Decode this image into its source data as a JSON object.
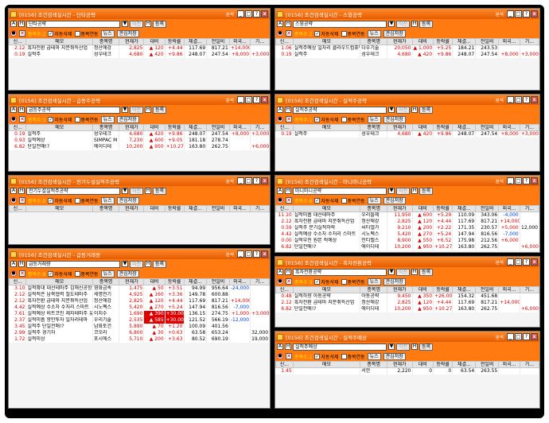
{
  "colors": {
    "title_bar": "#ff7a10",
    "up": "#e00000",
    "down": "#0044dd",
    "stock_highlight": "#ffff70"
  },
  "columns": [
    "신...",
    "메모",
    "종목명",
    "현재가",
    "대비",
    "등락률",
    "체결...",
    "전일비",
    "외국...",
    "기..."
  ],
  "icons": {
    "condition": "record-icon",
    "delete": "close-icon",
    "window": "window-icon",
    "up_arrow": "triangle-up-icon"
  },
  "panels": [
    {
      "window_title": "[0156] 조건검색실시간 - 단타공략",
      "caption": "분석",
      "condition": "단타공략",
      "count": "종목수:2",
      "first_memo": "",
      "rows": [
        [
          "2.12",
          "흑자전환 급테마 지분취득산업",
          "정산애강",
          "2,825",
          "▲ 120",
          "+4.44",
          "117.69",
          "817.21",
          "+14,000",
          ""
        ],
        [
          "0.19",
          "실적주",
          "성우테크",
          "4,680",
          "▲ 420",
          "+9.86",
          "248.07",
          "247.54",
          "+8,000",
          "+3,000"
        ]
      ]
    },
    {
      "window_title": "[0156] 조건검색실시간 - 스윙공략",
      "caption": "분석",
      "condition": "스윙공략",
      "count": "종목수:2",
      "first_memo": "",
      "rows": [
        [
          "1.06",
          "실적주예상 일자리 클라우드컴퓨팅",
          "다우기술",
          "20,050",
          "▲ 1,000",
          "+5.25",
          "184.21",
          "243.53",
          "",
          ""
        ],
        [
          "0.19",
          "실적주",
          "성우테크",
          "4,680",
          "▲ 420",
          "+9.86",
          "248.07",
          "247.54",
          "+8,000",
          "+3,000"
        ]
      ]
    },
    {
      "window_title": "[0156] 조건검색실시간 - 급등주공략",
      "caption": "분석",
      "condition": "급등주공략",
      "count": "종목수:3",
      "first_memo": "",
      "rows": [
        [
          "0.19",
          "실적주",
          "성우테크",
          "4,680",
          "▲ 420",
          "+9.86",
          "248.07",
          "247.54",
          "+8,000",
          "+3,000"
        ],
        [
          "0.93",
          "실적예상",
          "SIMPAC M",
          "7,230",
          "▲ 600",
          "+9.05",
          "181.18",
          "278.74",
          "",
          ""
        ],
        [
          "6.82",
          "단일전매!?",
          "에이디테",
          "10,200",
          "▲ 950",
          "+10.27",
          "163.80",
          "262.75",
          "",
          "+6,000"
        ]
      ]
    },
    {
      "window_title": "[0156] 조건검색실시간 - 실적주공략",
      "caption": "분석",
      "condition": "실적주공략",
      "count": "종목수:1",
      "first_memo": "",
      "rows": [
        [
          "0.19",
          "실적주",
          "성우테크",
          "4,680",
          "▲ 420",
          "+9.86",
          "248.07",
          "247.54",
          "+8,000",
          "+3,000"
        ]
      ]
    },
    {
      "window_title": "[0156] 조건검색실시간 - 전기누설실적주공략",
      "caption": "분석",
      "condition": "전기누설실적주공략",
      "count": "종목수:0",
      "first_memo": "",
      "rows": []
    },
    {
      "window_title": "[0156] 조건검색실시간 - 마니마니공략",
      "caption": "분석",
      "condition": "마니마니공략",
      "count": "종목수:6",
      "first_memo": "",
      "rows": [
        [
          "11.10",
          "실적미흡 대선테마주",
          "우리들제",
          "11,950",
          "▲ 600",
          "+5.29",
          "110.09",
          "343.06",
          "-4,000",
          ""
        ],
        [
          "2.12",
          "흑자전환 급테마 지분취득산업",
          "정산애강",
          "2,825",
          "▲ 120",
          "+4.44",
          "117.69",
          "817.21",
          "+14,000",
          ""
        ],
        [
          "0.59",
          "실적주 분기실적하락",
          "씨티엘가",
          "9,210",
          "▲ 200",
          "+2.22",
          "171.35",
          "230.57",
          "+5,000",
          "12,000"
        ],
        [
          "4.42",
          "실적예상 수소차 수처리 스마트",
          "시노펙스",
          "5,420",
          "▲ 270",
          "+5.24",
          "147.94",
          "816.56",
          "-7,000",
          ""
        ],
        [
          "0.00",
          "실적부진 원본 적예상",
          "인티벨스",
          "8,900",
          "▲ 550",
          "+6.52",
          "175.98",
          "212.56",
          "+6,000",
          ""
        ],
        [
          "6.82",
          "단일전매!?",
          "에이디테",
          "10,200",
          "▲ 950",
          "+10.27",
          "163.80",
          "262.75",
          "",
          "+6,000"
        ]
      ]
    },
    {
      "window_title": "[0156] 조건검색실시간 - 급등거래량",
      "caption": "분석",
      "condition": "급등거래량",
      "count": "종목수:9",
      "first_memo": "",
      "rows": [
        [
          "3.10",
          "실적확대 대선테마주 김해신공항",
          "영화금속",
          "1,475",
          "▲ 50",
          "+3.51",
          "94.99",
          "956.64",
          "-24,000",
          ""
        ],
        [
          "2.12",
          "실적적은 남북협력 철도테마주",
          "세명전기",
          "4,925",
          "▲ 160",
          "+3.36",
          "149.78",
          "600.88",
          "",
          ""
        ],
        [
          "2.12",
          "흑자전환 급테마 지분취득산업",
          "정산애강",
          "2,825",
          "▲ 120",
          "+4.44",
          "117.69",
          "817.21",
          "+14,000",
          ""
        ],
        [
          "4.42",
          "실적예상 수소차 수처리 스마트",
          "시노펙스",
          "5,420",
          "▲ 270",
          "+5.24",
          "147.94",
          "816.56",
          "-7,000",
          ""
        ],
        [
          "7.61",
          "실적예상 비트코인 제지테마주 유",
          "이지수",
          "1,690",
          "▲ 390",
          "+30.00",
          "136.15",
          "274.75",
          "+1,000",
          "+3,000"
        ],
        [
          "2.37",
          "실적미흡 항만투자 일자리테마",
          "우리기술",
          "2,535",
          "▲ 585",
          "+30.00",
          "121.52",
          "566.19",
          "-12,000",
          ""
        ],
        [
          "3.45",
          "실적주 단일전매!?",
          "남화토건",
          "5,890",
          "▲ 70",
          "+1.20",
          "100.09",
          "401.56",
          "",
          ""
        ],
        [
          "2.99",
          "실적주 경기자",
          "코오라",
          "6,800",
          "▲ 30",
          "+0.63",
          "63.58",
          "653.24",
          "",
          "32,000"
        ],
        [
          "1.72",
          "실적미상",
          "포시에스",
          "5,710",
          "▲ 200",
          "+3.63",
          "80.52",
          "690.19",
          "",
          "19,000"
        ]
      ]
    },
    {
      "window_title": "[0156] 조건검색실시간 - 흑자전환공략",
      "caption": "분석",
      "condition": "흑자전환공략",
      "count": "종목수:3",
      "first_memo": "",
      "rows": [
        [
          "0.48",
          "실적하향 아동공략",
          "아동공략",
          "9,450",
          "▲ 350",
          "+26.00",
          "154.32",
          "451.68",
          "",
          ""
        ],
        [
          "2.12",
          "흑자전환 급테마 지분취득산업",
          "정산애강",
          "2,825",
          "▲ 120",
          "+4.44",
          "117.69",
          "817.21",
          "+14,000",
          ""
        ],
        [
          "6.82",
          "단일전매!?",
          "에이디테",
          "10,200",
          "▲ 950",
          "+10.27",
          "163.80",
          "262.75",
          "",
          "+6,000"
        ]
      ]
    },
    {
      "window_title": "[0156] 조건검색실시간 - 실적주예상",
      "caption": "분석",
      "condition": "실적주예상",
      "count": "종목수:1",
      "first_memo": "",
      "rows": [
        [
          "1.45",
          "",
          "서한",
          "2,220",
          "0",
          "0",
          "63.54",
          "263.55",
          "",
          ""
        ]
      ]
    }
  ],
  "labels": {
    "a1": "A",
    "h": "H",
    "prev": "이전",
    "register": "등록",
    "next": "다음",
    "auto_delete": "자동삭제",
    "duplicate": "중복연동",
    "news": "뉴스",
    "save": "관심저장",
    "dropdown": "▼",
    "win_min": "_",
    "win_max": "□",
    "win_close": "x",
    "win_help": "?"
  }
}
